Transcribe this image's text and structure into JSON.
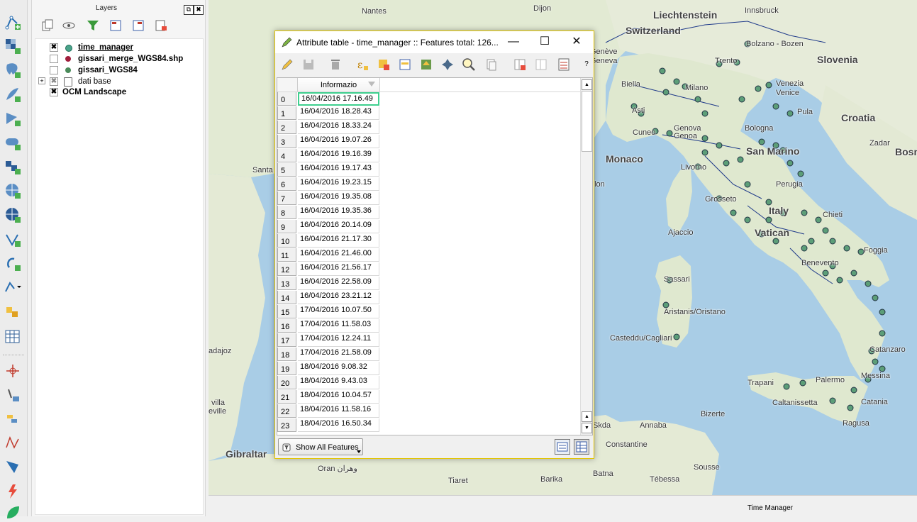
{
  "layers_panel": {
    "title": "Layers",
    "float_label": "⧉",
    "close_label": "✖",
    "layers": [
      {
        "name": "time_manager",
        "checked": true,
        "symbol": "#4aa38a"
      },
      {
        "name": "gissari_merge_WGS84.shp",
        "checked": false,
        "symbol": "#a01e3c"
      },
      {
        "name": "gissari_WGS84",
        "checked": false,
        "symbol": "#4a8a5a"
      },
      {
        "name": "dati base",
        "checked": true,
        "group": true
      },
      {
        "name": "OCM Landscape",
        "checked": true
      }
    ],
    "check_mark": "✖",
    "expand_mark": "+"
  },
  "attribute_table": {
    "title": "Attribute table - time_manager :: Features total: 126...",
    "column_header": "Informazio",
    "minimize_label": "—",
    "maximize_label": "☐",
    "close_label": "✕",
    "help_label": "?",
    "rows": [
      {
        "index": "0",
        "value": "16/04/2016 17.16.49"
      },
      {
        "index": "1",
        "value": "16/04/2016 18.28.43"
      },
      {
        "index": "2",
        "value": "16/04/2016 18.33.24"
      },
      {
        "index": "3",
        "value": "16/04/2016 19.07.26"
      },
      {
        "index": "4",
        "value": "16/04/2016 19.16.39"
      },
      {
        "index": "5",
        "value": "16/04/2016 19.17.43"
      },
      {
        "index": "6",
        "value": "16/04/2016 19.23.15"
      },
      {
        "index": "7",
        "value": "16/04/2016 19.35.08"
      },
      {
        "index": "8",
        "value": "16/04/2016 19.35.36"
      },
      {
        "index": "9",
        "value": "16/04/2016 20.14.09"
      },
      {
        "index": "10",
        "value": "16/04/2016 21.17.30"
      },
      {
        "index": "11",
        "value": "16/04/2016 21.46.00"
      },
      {
        "index": "12",
        "value": "16/04/2016 21.56.17"
      },
      {
        "index": "13",
        "value": "16/04/2016 22.58.09"
      },
      {
        "index": "14",
        "value": "16/04/2016 23.21.12"
      },
      {
        "index": "15",
        "value": "17/04/2016 10.07.50"
      },
      {
        "index": "16",
        "value": "17/04/2016 11.58.03"
      },
      {
        "index": "17",
        "value": "17/04/2016 12.24.11"
      },
      {
        "index": "18",
        "value": "17/04/2016 21.58.09"
      },
      {
        "index": "19",
        "value": "18/04/2016 9.08.32"
      },
      {
        "index": "20",
        "value": "18/04/2016 9.43.03"
      },
      {
        "index": "21",
        "value": "18/04/2016 10.04.57"
      },
      {
        "index": "22",
        "value": "18/04/2016 11.58.16"
      },
      {
        "index": "23",
        "value": "18/04/2016 16.50.34"
      }
    ],
    "show_all_button": "Show All Features"
  },
  "map": {
    "labels": [
      {
        "text": "Nantes",
        "cls": "",
        "pos": "a"
      },
      {
        "text": "Dijon",
        "cls": "",
        "pos": "b"
      },
      {
        "text": "Liechtenstein",
        "cls": "big",
        "pos": "c"
      },
      {
        "text": "Innsbruck",
        "cls": "",
        "pos": "d"
      },
      {
        "text": "Switzerland",
        "cls": "big",
        "pos": "e"
      },
      {
        "text": "Bolzano - Bozen",
        "cls": "",
        "pos": "f"
      },
      {
        "text": "Slovenia",
        "cls": "big",
        "pos": "g"
      },
      {
        "text": "Trento",
        "cls": "",
        "pos": "h"
      },
      {
        "text": "Genève",
        "cls": "",
        "pos": "i"
      },
      {
        "text": "Geneva",
        "cls": "",
        "pos": "j"
      },
      {
        "text": "Biella",
        "cls": "",
        "pos": "k"
      },
      {
        "text": "Milano",
        "cls": "",
        "pos": "l"
      },
      {
        "text": "Venezia",
        "cls": "",
        "pos": "m"
      },
      {
        "text": "Venice",
        "cls": "",
        "pos": "n"
      },
      {
        "text": "Asti",
        "cls": "",
        "pos": "o"
      },
      {
        "text": "Pula",
        "cls": "",
        "pos": "p"
      },
      {
        "text": "Croatia",
        "cls": "big",
        "pos": "q"
      },
      {
        "text": "Cuneo",
        "cls": "",
        "pos": "r"
      },
      {
        "text": "Genova",
        "cls": "",
        "pos": "s"
      },
      {
        "text": "Genoa",
        "cls": "",
        "pos": "t"
      },
      {
        "text": "Bologna",
        "cls": "",
        "pos": "u"
      },
      {
        "text": "Zadar",
        "cls": "",
        "pos": "v"
      },
      {
        "text": "Monaco",
        "cls": "big",
        "pos": "w"
      },
      {
        "text": "San Marino",
        "cls": "big",
        "pos": "x"
      },
      {
        "text": "Bosn",
        "cls": "big",
        "pos": "y"
      },
      {
        "text": "Santa",
        "cls": "",
        "pos": "z"
      },
      {
        "text": "Livorno",
        "cls": "",
        "pos": "aa"
      },
      {
        "text": "Perugia",
        "cls": "",
        "pos": "ab"
      },
      {
        "text": "ulon",
        "cls": "",
        "pos": "ac"
      },
      {
        "text": "Grosseto",
        "cls": "",
        "pos": "ad"
      },
      {
        "text": "Italy",
        "cls": "big",
        "pos": "ae"
      },
      {
        "text": "Chieti",
        "cls": "",
        "pos": "af"
      },
      {
        "text": "Ajaccio",
        "cls": "",
        "pos": "ag"
      },
      {
        "text": "Vatican",
        "cls": "big",
        "pos": "ah"
      },
      {
        "text": "Foggia",
        "cls": "",
        "pos": "ai"
      },
      {
        "text": "Benevento",
        "cls": "",
        "pos": "aj"
      },
      {
        "text": "Sassari",
        "cls": "",
        "pos": "ak"
      },
      {
        "text": "Aristanis/Oristano",
        "cls": "",
        "pos": "al"
      },
      {
        "text": "Casteddu/Cagliari",
        "cls": "",
        "pos": "am"
      },
      {
        "text": "adajoz",
        "cls": "",
        "pos": "an"
      },
      {
        "text": "Catanzaro",
        "cls": "",
        "pos": "ao"
      },
      {
        "text": "Trapani",
        "cls": "",
        "pos": "ap"
      },
      {
        "text": "Palermo",
        "cls": "",
        "pos": "aq"
      },
      {
        "text": "Messina",
        "cls": "",
        "pos": "ar"
      },
      {
        "text": "Caltanissetta",
        "cls": "",
        "pos": "as"
      },
      {
        "text": "Catania",
        "cls": "",
        "pos": "at"
      },
      {
        "text": "Ragusa",
        "cls": "",
        "pos": "au"
      },
      {
        "text": "Bizerte",
        "cls": "",
        "pos": "av"
      },
      {
        "text": "villa",
        "cls": "",
        "pos": "aw"
      },
      {
        "text": "eville",
        "cls": "",
        "pos": "ax"
      },
      {
        "text": "Gibraltar",
        "cls": "big",
        "pos": "ay"
      },
      {
        "text": "Skda",
        "cls": "",
        "pos": "az"
      },
      {
        "text": "Annaba",
        "cls": "",
        "pos": "ba"
      },
      {
        "text": "Constantine",
        "cls": "",
        "pos": "bb"
      },
      {
        "text": "Oran وهران",
        "cls": "",
        "pos": "bc"
      },
      {
        "text": "Batna",
        "cls": "",
        "pos": "bd"
      },
      {
        "text": "Sousse",
        "cls": "",
        "pos": "be"
      },
      {
        "text": "Tiaret",
        "cls": "",
        "pos": "bf"
      },
      {
        "text": "Barika",
        "cls": "",
        "pos": "bg"
      },
      {
        "text": "Tébessa",
        "cls": "",
        "pos": "bh"
      }
    ],
    "status_label": "Time Manager"
  },
  "colors": {
    "sea": "#a9cde6",
    "land": "#e3ead6",
    "point": "#5c9e78",
    "dialog_border": "#e2c400",
    "selection": "#3ecf8e"
  },
  "icons": [
    "digitize-icon",
    "raster-icon",
    "postgis-icon",
    "spatialite-icon",
    "mssql-icon",
    "oracle-icon",
    "db2-icon",
    "raster-wms-icon",
    "wcs-icon",
    "wfs-icon",
    "new-shapefile-icon",
    "spatialite-layer-icon",
    "gps-icon",
    "virtual-layer-icon",
    "table-icon",
    "crosshair-icon",
    "add-vertex-icon",
    "reshape-icon",
    "split-icon",
    "polygon-icon",
    "lightning-icon",
    "leaf-icon"
  ]
}
